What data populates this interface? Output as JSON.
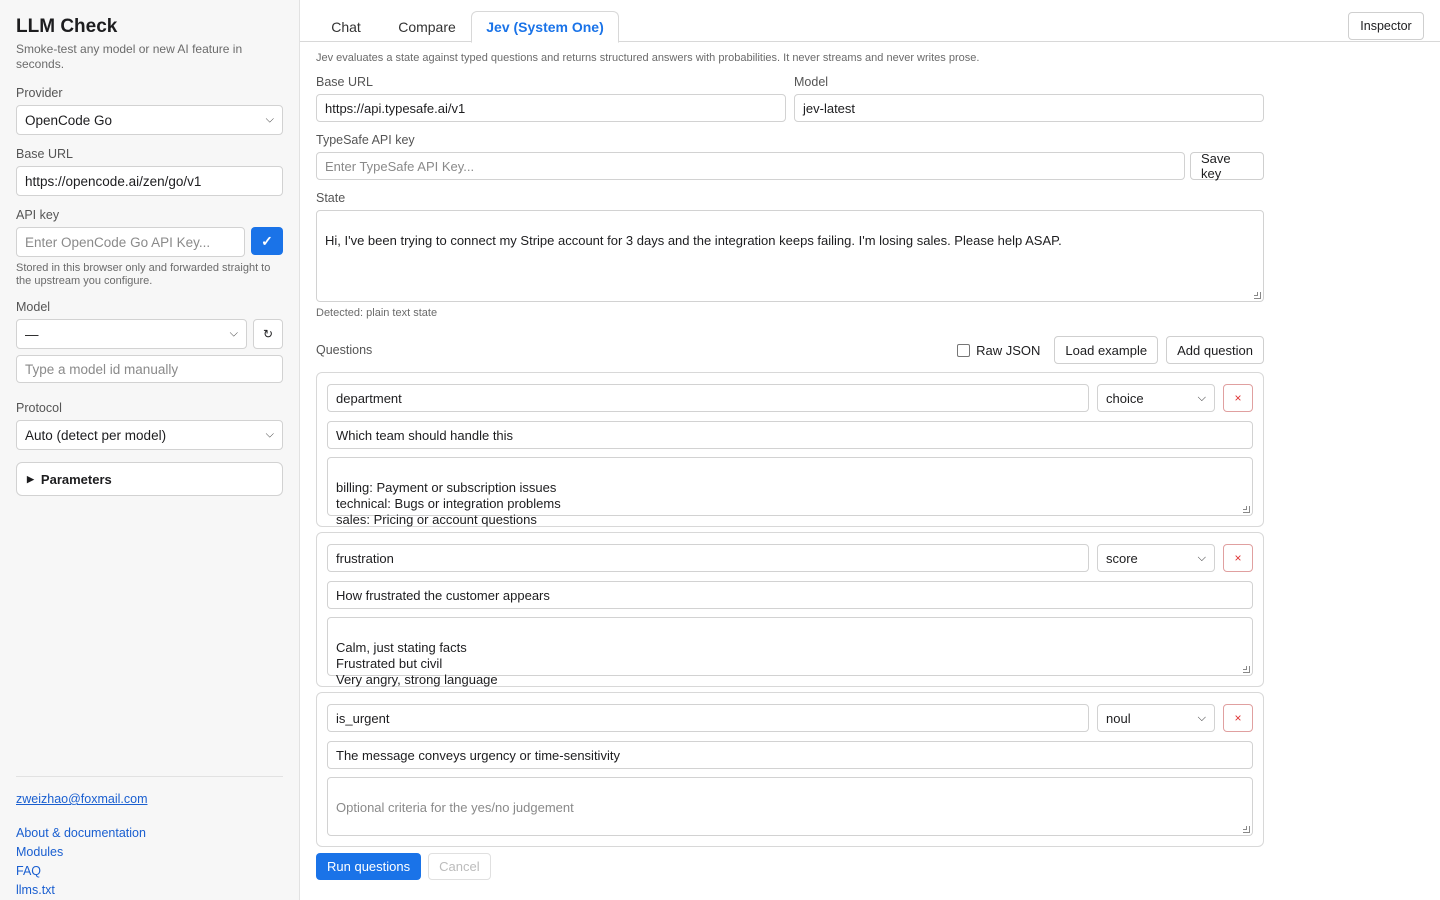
{
  "sidebar": {
    "title": "LLM Check",
    "subtitle": "Smoke-test any model or new AI feature in seconds.",
    "provider": {
      "label": "Provider",
      "value": "OpenCode Go"
    },
    "base_url": {
      "label": "Base URL",
      "value": "https://opencode.ai/zen/go/v1"
    },
    "api_key": {
      "label": "API key",
      "placeholder": "Enter OpenCode Go API Key...",
      "confirm": "✓",
      "hint": "Stored in this browser only and forwarded straight to the upstream you configure."
    },
    "model": {
      "label": "Model",
      "value": "—",
      "refresh": "↻",
      "manual_placeholder": "Type a model id manually"
    },
    "protocol": {
      "label": "Protocol",
      "value": "Auto (detect per model)"
    },
    "parameters": "Parameters",
    "email": "zweizhao@foxmail.com",
    "links": [
      "About & documentation",
      "Modules",
      "FAQ",
      "llms.txt"
    ]
  },
  "tabs": [
    "Chat",
    "Compare",
    "Jev (System One)"
  ],
  "inspector": "Inspector",
  "jev": {
    "description": "Jev evaluates a state against typed questions and returns structured answers with probabilities. It never streams and never writes prose.",
    "base_url": {
      "label": "Base URL",
      "value": "https://api.typesafe.ai/v1"
    },
    "model": {
      "label": "Model",
      "value": "jev-latest"
    },
    "api_key": {
      "label": "TypeSafe API key",
      "placeholder": "Enter TypeSafe API Key...",
      "save": "Save key"
    },
    "state": {
      "label": "State",
      "value": "Hi, I've been trying to connect my Stripe account for 3 days and the integration keeps failing. I'm losing sales. Please help ASAP.",
      "detected": "Detected: plain text state"
    },
    "questions": {
      "label": "Questions",
      "raw_json": "Raw JSON",
      "load_example": "Load example",
      "add_question": "Add question",
      "items": [
        {
          "key": "department",
          "type": "choice",
          "prompt": "Which team should handle this",
          "detail": "billing: Payment or subscription issues\ntechnical: Bugs or integration problems\nsales: Pricing or account questions",
          "delete": "×"
        },
        {
          "key": "frustration",
          "type": "score",
          "prompt": "How frustrated the customer appears",
          "detail": "Calm, just stating facts\nFrustrated but civil\nVery angry, strong language",
          "delete": "×"
        },
        {
          "key": "is_urgent",
          "type": "noul",
          "prompt": "The message conveys urgency or time-sensitivity",
          "detail_placeholder": "Optional criteria for the yes/no judgement",
          "delete": "×"
        }
      ]
    },
    "run": "Run questions",
    "cancel": "Cancel"
  },
  "colors": {
    "accent": "#1a73e8",
    "danger": "#d33333"
  },
  "icons": {
    "select": "chevron-down-icon",
    "confirm": "checkmark-icon",
    "refresh": "refresh-icon",
    "delete": "close-icon",
    "disclosure": "triangle-right-icon"
  }
}
